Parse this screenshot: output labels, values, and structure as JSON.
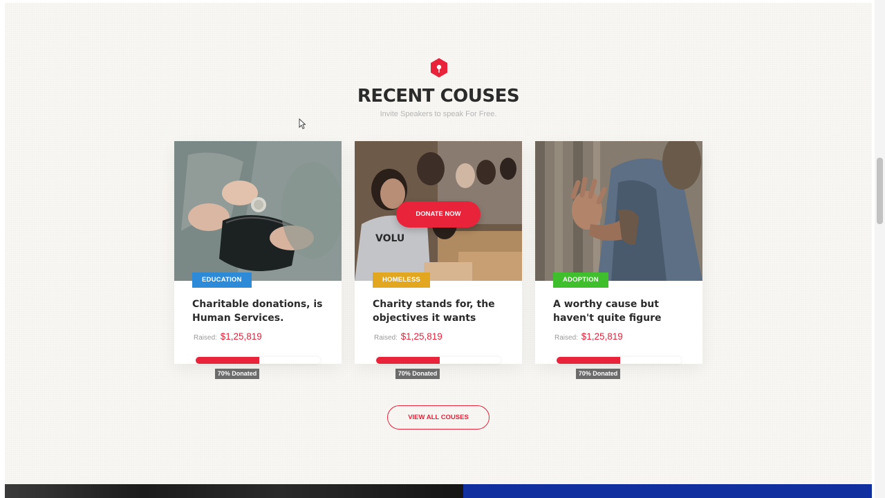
{
  "section": {
    "title": "RECENT COUSES",
    "subtitle": "Invite Speakers  to speak For Free."
  },
  "colors": {
    "accent": "#e8233a",
    "badge_education": "#2d8ad8",
    "badge_homeless": "#e2a61f",
    "badge_adoption": "#3fbf2c",
    "footer_blue": "#112f9e"
  },
  "cards": [
    {
      "category": "EDUCATION",
      "title": "Charitable donations, is Human Services.",
      "raised_label": "Raised:",
      "raised_amount": "$1,25,819",
      "progress_percent": 70,
      "progress_label": "70% Donated",
      "image_icon": "wallet-coin-photo"
    },
    {
      "category": "HOMELESS",
      "title": "Charity stands for, the objectives it wants",
      "raised_label": "Raised:",
      "raised_amount": "$1,25,819",
      "progress_percent": 70,
      "progress_label": "70% Donated",
      "image_icon": "volunteers-photo",
      "donate_button": "DONATE NOW"
    },
    {
      "category": "ADOPTION",
      "title": "A worthy cause but haven't quite figure",
      "raised_label": "Raised:",
      "raised_amount": "$1,25,819",
      "progress_percent": 70,
      "progress_label": "70% Donated",
      "image_icon": "outstretched-hand-photo"
    }
  ],
  "view_all_label": "VIEW ALL COUSES"
}
